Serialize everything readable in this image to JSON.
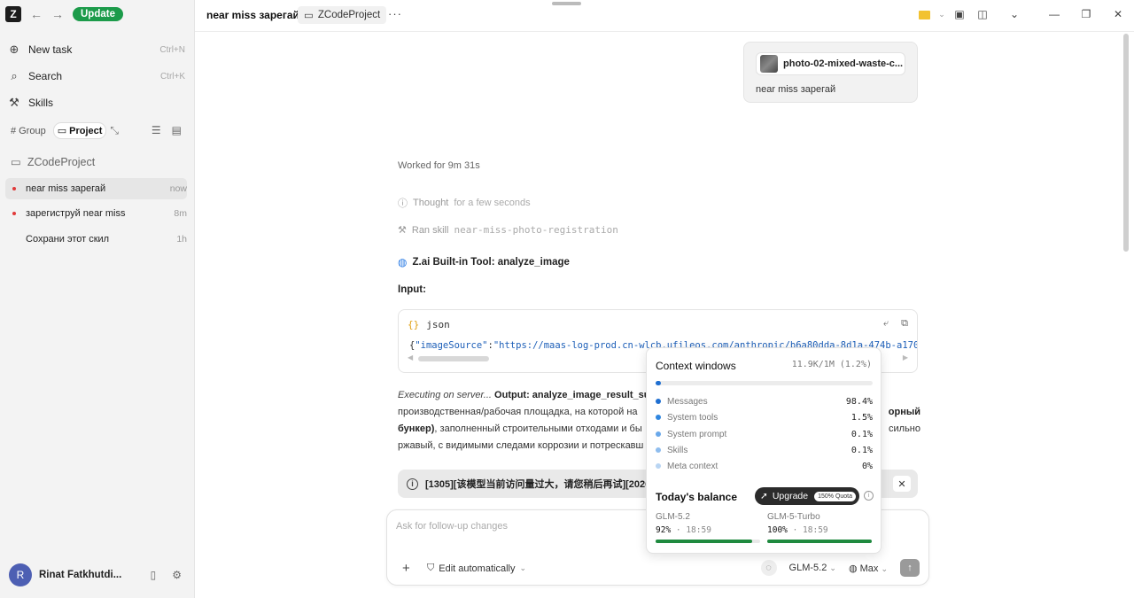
{
  "sidebar": {
    "logo": "Z",
    "update_label": "Update",
    "menu": [
      {
        "label": "New task",
        "shortcut": "Ctrl+N"
      },
      {
        "label": "Search",
        "shortcut": "Ctrl+K"
      },
      {
        "label": "Skills",
        "shortcut": ""
      }
    ],
    "segments": {
      "group": "Group",
      "project": "Project"
    },
    "project_name": "ZCodeProject",
    "threads": [
      {
        "title": "near miss зарегай",
        "time": "now",
        "dot": true
      },
      {
        "title": "зарегиструй near miss",
        "time": "8m",
        "dot": true
      },
      {
        "title": "Сохрани этот скил",
        "time": "1h",
        "dot": false
      }
    ],
    "user": {
      "initial": "R",
      "name": "Rinat Fatkhutdi..."
    }
  },
  "titlebar": {
    "title": "near miss зарегай",
    "project_chip": "ZCodeProject",
    "more": "···"
  },
  "chat": {
    "user_message": {
      "attachment": "photo-02-mixed-waste-c...",
      "text": "near miss зарегай"
    },
    "worked_for": "Worked for 9m 31s",
    "thought": {
      "label": "Thought",
      "sub": "for a few seconds"
    },
    "ran_skill": {
      "label": "Ran skill",
      "sub": "near-miss-photo-registration"
    },
    "tool_title": "Z.ai Built-in Tool: analyze_image",
    "input_label": "Input:",
    "code": {
      "lang": "json",
      "key": "\"imageSource\"",
      "value": "\"https://maas-log-prod.cn-wlcb.ufileos.com/anthropic/b6a80dda-8d1a-474b-a170-4d8eef"
    },
    "exec": {
      "executing": "Executing on server...",
      "output_label": "Output: analyze_image_result_sum",
      "line2_start": "производственная/рабочая площадка, на которой на",
      "line2_end": "орный",
      "line3_bold": "бункер)",
      "line3_text": ", заполненный строительными отходами и бы",
      "line3_end": "сильно",
      "line4": "ржавый, с видимыми следами коррозии и потрескавш"
    },
    "error": "[1305][该模型当前访问量过大，请您稍后再试][2026"
  },
  "composer": {
    "placeholder": "Ask for follow-up changes",
    "edit_mode": "Edit automatically",
    "model": "GLM-5.2",
    "effort": "Max"
  },
  "context_popup": {
    "title": "Context windows",
    "total": "11.9K/1M (1.2%)",
    "usage_fraction": 0.012,
    "rows": [
      {
        "label": "Messages",
        "value": "98.4%",
        "color": "#1f6fd1"
      },
      {
        "label": "System tools",
        "value": "1.5%",
        "color": "#2f86e0"
      },
      {
        "label": "System prompt",
        "value": "0.1%",
        "color": "#6aa8ea"
      },
      {
        "label": "Skills",
        "value": "0.1%",
        "color": "#8fbdee"
      },
      {
        "label": "Meta context",
        "value": "0%",
        "color": "#b9d5f3"
      }
    ],
    "balance_title": "Today's balance",
    "upgrade_label": "Upgrade",
    "quota_badge": "150% Quota",
    "models": [
      {
        "name": "GLM-5.2",
        "pct": "92%",
        "reset": " · 18:59",
        "fill": 0.92
      },
      {
        "name": "GLM-5-Turbo",
        "pct": "100%",
        "reset": " · 18:59",
        "fill": 1.0
      }
    ]
  },
  "colors": {
    "accent_green": "#1c9b4a",
    "progress_green": "#1f8a3f",
    "link_blue": "#2a7be4"
  }
}
